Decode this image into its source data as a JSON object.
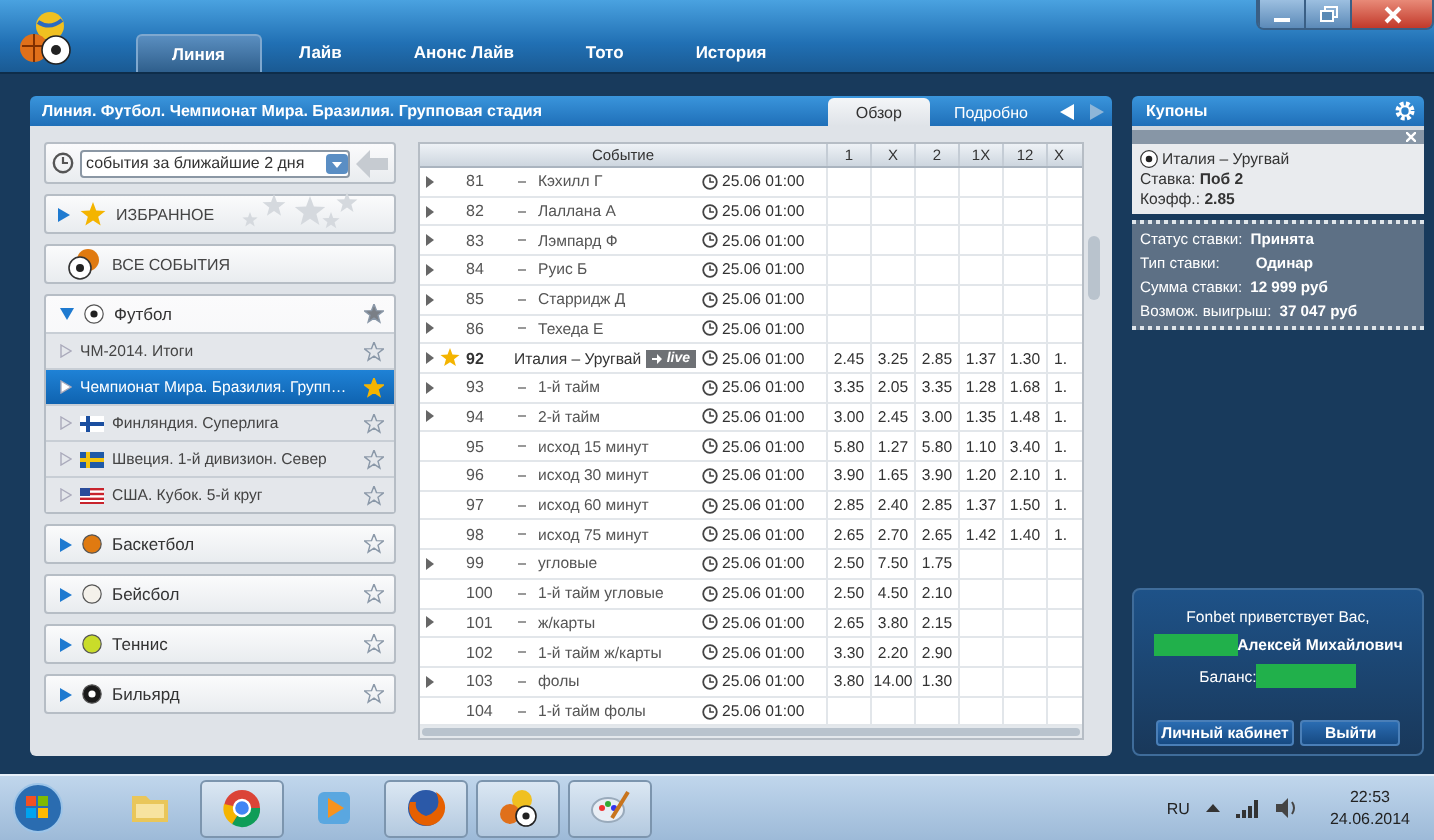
{
  "tabs": [
    {
      "label": "Линия",
      "selected": true
    },
    {
      "label": "Лайв",
      "selected": false
    },
    {
      "label": "Анонс Лайв",
      "selected": false
    },
    {
      "label": "Тото",
      "selected": false
    },
    {
      "label": "История",
      "selected": false
    }
  ],
  "breadcrumb": "Линия. Футбол. Чемпионат Мира. Бразилия. Групповая стадия",
  "view_tabs": [
    {
      "label": "Обзор",
      "selected": true
    },
    {
      "label": "Подробно",
      "selected": false
    }
  ],
  "filter": {
    "value": "события за ближайшие 2 дня"
  },
  "favorites": {
    "label": "ИЗБРАННОЕ"
  },
  "all_events": {
    "label": "ВСЕ СОБЫТИЯ"
  },
  "sports": [
    {
      "name": "Футбол",
      "kind": "football",
      "expanded": true,
      "favorite": true,
      "children": [
        {
          "name": "ЧМ-2014. Итоги",
          "kind": "plain",
          "selected": false,
          "favorite": false
        },
        {
          "name": "Чемпионат Мира. Бразилия. Групп…",
          "kind": "plain",
          "selected": true,
          "favorite": true
        },
        {
          "name": "Финляндия. Суперлига",
          "kind": "finland",
          "selected": false,
          "favorite": false
        },
        {
          "name": "Швеция. 1-й дивизион. Север",
          "kind": "sweden",
          "selected": false,
          "favorite": false
        },
        {
          "name": "США. Кубок. 5-й круг",
          "kind": "usa",
          "selected": false,
          "favorite": false
        }
      ]
    },
    {
      "name": "Баскетбол",
      "kind": "basketball",
      "expanded": false,
      "favorite": false
    },
    {
      "name": "Бейсбол",
      "kind": "baseball",
      "expanded": false,
      "favorite": false
    },
    {
      "name": "Теннис",
      "kind": "tennis",
      "expanded": false,
      "favorite": false
    },
    {
      "name": "Бильярд",
      "kind": "billiards",
      "expanded": false,
      "favorite": false
    }
  ],
  "table": {
    "columns": [
      "Событие",
      "1",
      "X",
      "2",
      "1X",
      "12",
      "X"
    ],
    "rows": [
      {
        "kind": "market",
        "number": "81",
        "name": "Кэхилл Г",
        "time": "25.06 01:00",
        "expandable": true,
        "odds": []
      },
      {
        "kind": "market",
        "number": "82",
        "name": "Лаллана А",
        "time": "25.06 01:00",
        "expandable": true,
        "odds": []
      },
      {
        "kind": "market",
        "number": "83",
        "name": "Лэмпард Ф",
        "time": "25.06 01:00",
        "expandable": true,
        "odds": []
      },
      {
        "kind": "market",
        "number": "84",
        "name": "Руис Б",
        "time": "25.06 01:00",
        "expandable": true,
        "odds": []
      },
      {
        "kind": "market",
        "number": "85",
        "name": "Старридж Д",
        "time": "25.06 01:00",
        "expandable": true,
        "odds": []
      },
      {
        "kind": "market",
        "number": "86",
        "name": "Техеда Е",
        "time": "25.06 01:00",
        "expandable": true,
        "odds": []
      },
      {
        "kind": "event",
        "number": "92",
        "name": "Италия – Уругвай",
        "live_badge": "live",
        "favorite": true,
        "time": "25.06 01:00",
        "expandable": true,
        "odds": [
          "2.45",
          "3.25",
          "2.85",
          "1.37",
          "1.30",
          "1."
        ]
      },
      {
        "kind": "market",
        "number": "93",
        "name": "1-й тайм",
        "time": "25.06 01:00",
        "expandable": true,
        "odds": [
          "3.35",
          "2.05",
          "3.35",
          "1.28",
          "1.68",
          "1."
        ]
      },
      {
        "kind": "market",
        "number": "94",
        "name": "2-й тайм",
        "time": "25.06 01:00",
        "expandable": true,
        "odds": [
          "3.00",
          "2.45",
          "3.00",
          "1.35",
          "1.48",
          "1."
        ]
      },
      {
        "kind": "market",
        "number": "95",
        "name": "исход 15 минут",
        "time": "25.06 01:00",
        "expandable": false,
        "odds": [
          "5.80",
          "1.27",
          "5.80",
          "1.10",
          "3.40",
          "1."
        ]
      },
      {
        "kind": "market",
        "number": "96",
        "name": "исход 30 минут",
        "time": "25.06 01:00",
        "expandable": false,
        "odds": [
          "3.90",
          "1.65",
          "3.90",
          "1.20",
          "2.10",
          "1."
        ]
      },
      {
        "kind": "market",
        "number": "97",
        "name": "исход 60 минут",
        "time": "25.06 01:00",
        "expandable": false,
        "odds": [
          "2.85",
          "2.40",
          "2.85",
          "1.37",
          "1.50",
          "1."
        ]
      },
      {
        "kind": "market",
        "number": "98",
        "name": "исход 75 минут",
        "time": "25.06 01:00",
        "expandable": false,
        "odds": [
          "2.65",
          "2.70",
          "2.65",
          "1.42",
          "1.40",
          "1."
        ]
      },
      {
        "kind": "market",
        "number": "99",
        "name": "угловые",
        "time": "25.06 01:00",
        "expandable": true,
        "odds": [
          "2.50",
          "7.50",
          "1.75"
        ]
      },
      {
        "kind": "market",
        "number": "100",
        "name": "1-й тайм угловые",
        "time": "25.06 01:00",
        "expandable": false,
        "odds": [
          "2.50",
          "4.50",
          "2.10"
        ]
      },
      {
        "kind": "market",
        "number": "101",
        "name": "ж/карты",
        "time": "25.06 01:00",
        "expandable": true,
        "odds": [
          "2.65",
          "3.80",
          "2.15"
        ]
      },
      {
        "kind": "market",
        "number": "102",
        "name": "1-й тайм ж/карты",
        "time": "25.06 01:00",
        "expandable": false,
        "odds": [
          "3.30",
          "2.20",
          "2.90"
        ]
      },
      {
        "kind": "market",
        "number": "103",
        "name": "фолы",
        "time": "25.06 01:00",
        "expandable": true,
        "odds": [
          "3.80",
          "14.00",
          "1.30"
        ]
      },
      {
        "kind": "market",
        "number": "104",
        "name": "1-й тайм фолы",
        "time": "25.06 01:00",
        "expandable": false,
        "odds": []
      }
    ]
  },
  "coupons": {
    "title": "Купоны",
    "match": "Италия – Уругвай",
    "bet": "Ставка: **Поб 2**",
    "odds": "Коэфф.: **2.85**",
    "details": [
      {
        "label": "Статус ставки:",
        "value": "Принята"
      },
      {
        "label": "Тип ставки:",
        "value": "Одинар"
      },
      {
        "label": "Сумма ставки:",
        "value": "12 999 руб"
      },
      {
        "label": "Возмож. выигрыш:",
        "value": "37 047 руб"
      }
    ]
  },
  "account": {
    "greeting": "Fonbet приветствует Вас,",
    "name": "Алексей Михайлович",
    "balance_label": "Баланс:",
    "buttons": [
      "Личный кабинет",
      "Выйти"
    ]
  },
  "taskbar": {
    "apps": [
      {
        "kind": "folder",
        "running": false
      },
      {
        "kind": "browser",
        "running": true
      },
      {
        "kind": "media",
        "running": false
      },
      {
        "kind": "firefox",
        "running": true
      },
      {
        "kind": "sports",
        "running": true
      },
      {
        "kind": "paint",
        "running": true
      }
    ],
    "language": "RU",
    "time": "22:53",
    "date": "24.06.2014"
  }
}
